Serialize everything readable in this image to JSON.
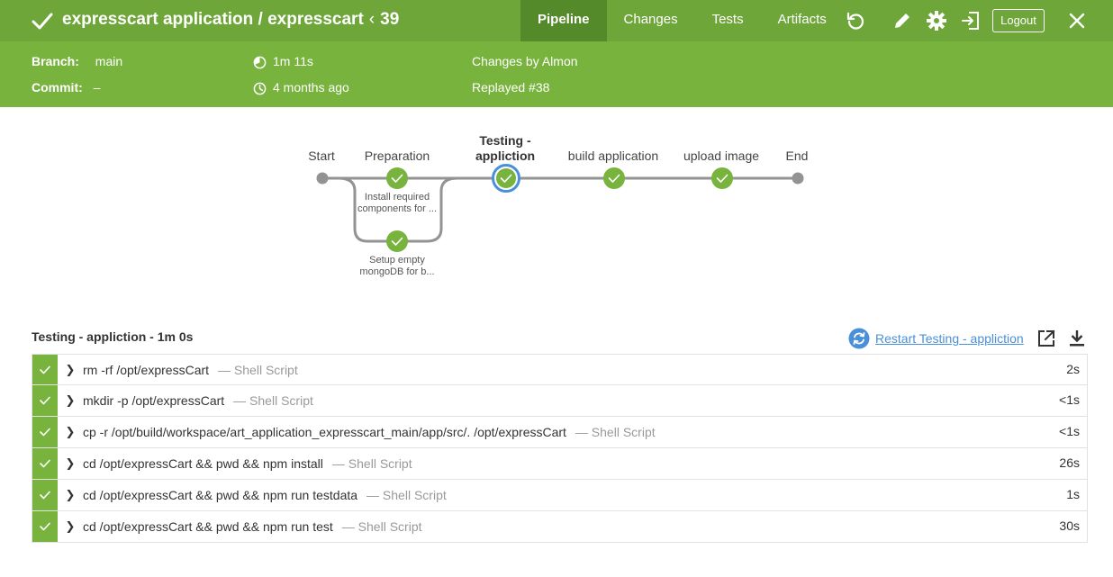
{
  "header": {
    "title": "expresscart application / expresscart",
    "run_number": "39",
    "tabs": [
      "Pipeline",
      "Changes",
      "Tests",
      "Artifacts"
    ],
    "active_tab": "Pipeline",
    "logout_label": "Logout"
  },
  "meta": {
    "branch_label": "Branch:",
    "branch_value": "main",
    "commit_label": "Commit:",
    "commit_value": "–",
    "duration": "1m 11s",
    "time_ago": "4 months ago",
    "changes": "Changes by Almon",
    "replayed": "Replayed #38"
  },
  "graph": {
    "stages": [
      {
        "label": "Start"
      },
      {
        "label": "Preparation"
      },
      {
        "label_line1": "Testing -",
        "label_line2": "appliction"
      },
      {
        "label": "build application"
      },
      {
        "label": "upload image"
      },
      {
        "label": "End"
      }
    ],
    "parallel": [
      {
        "line1": "Install required",
        "line2": "components for ..."
      },
      {
        "line1": "Setup empty",
        "line2": "mongoDB for b..."
      }
    ]
  },
  "steps_panel": {
    "heading": "Testing - appliction - 1m 0s",
    "restart_label": "Restart Testing - appliction",
    "steps": [
      {
        "cmd": "rm -rf /opt/expressCart",
        "type": "— Shell Script",
        "duration": "2s"
      },
      {
        "cmd": "mkdir -p /opt/expressCart",
        "type": "— Shell Script",
        "duration": "<1s"
      },
      {
        "cmd": "cp -r /opt/build/workspace/art_application_expresscart_main/app/src/. /opt/expressCart",
        "type": "— Shell Script",
        "duration": "<1s"
      },
      {
        "cmd": "cd /opt/expressCart && pwd && npm install",
        "type": "— Shell Script",
        "duration": "26s"
      },
      {
        "cmd": "cd /opt/expressCart && pwd && npm run testdata",
        "type": "— Shell Script",
        "duration": "1s"
      },
      {
        "cmd": "cd /opt/expressCart && pwd && npm run test",
        "type": "— Shell Script",
        "duration": "30s"
      }
    ]
  },
  "colors": {
    "header_green": "#6ea63a",
    "subbar_green": "#78b33e",
    "active_tab": "#548a2a",
    "success_green": "#78b33e",
    "selected_blue": "#4a90d9",
    "edge_gray": "#949393"
  }
}
